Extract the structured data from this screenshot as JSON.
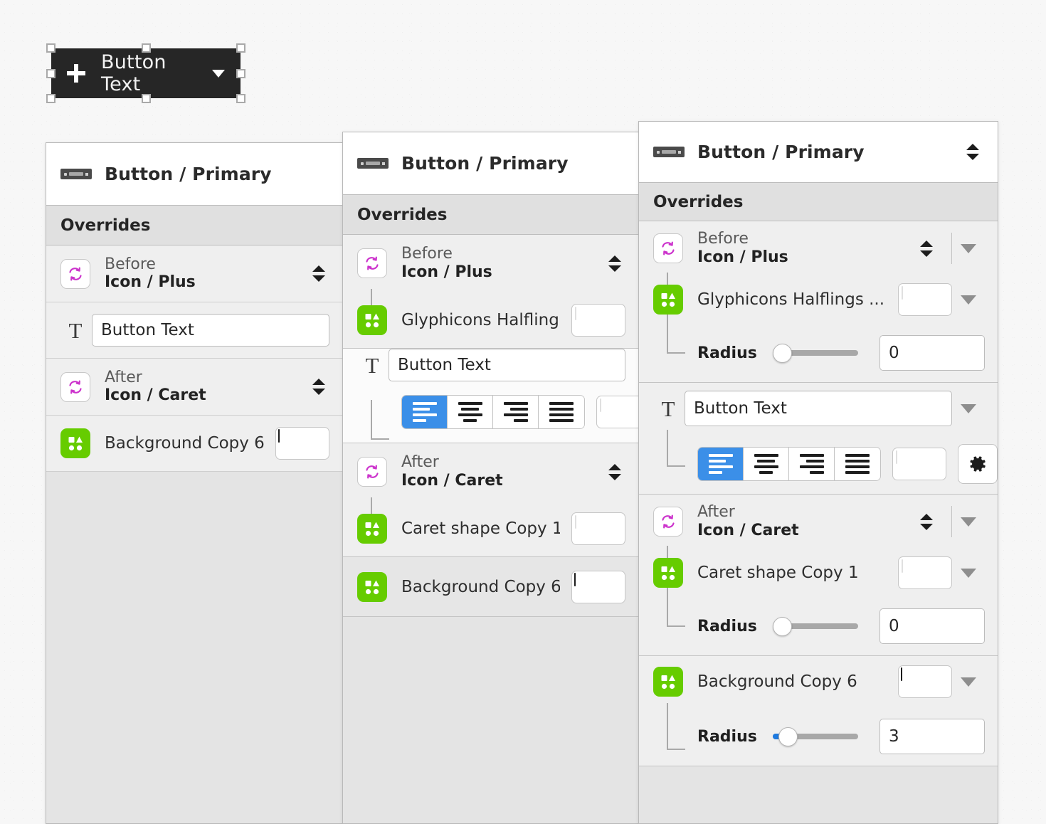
{
  "canvas": {
    "button_preview": {
      "label": "Button Text",
      "plus_icon": "plus-icon",
      "caret_icon": "caret-down-icon",
      "background_color": "#262626",
      "text_color": "#f2f2f2"
    }
  },
  "colors": {
    "accent_blue": "#3b8fe8",
    "slider_blue": "#1d7ae0",
    "symbol_magenta": "#cc33cc",
    "shape_green": "#66cc00",
    "dark_swatch": "#262626",
    "white_swatch": "#ffffff"
  },
  "panels": [
    {
      "id": "panel-1",
      "title": "Button / Primary",
      "section_title": "Overrides",
      "rows": [
        {
          "kind": "symbol",
          "icon": "symbol-instance-icon",
          "sub_label": "Before",
          "main_label": "Icon / Plus",
          "stepper": "stepper-updown"
        },
        {
          "kind": "text",
          "icon": "text-override-icon",
          "value": "Button Text"
        },
        {
          "kind": "symbol",
          "icon": "symbol-instance-icon",
          "sub_label": "After",
          "main_label": "Icon / Caret",
          "stepper": "stepper-updown"
        },
        {
          "kind": "shape",
          "icon": "shapes-icon",
          "label": "Background Copy 6",
          "swatch": "#262626"
        }
      ]
    },
    {
      "id": "panel-2",
      "title": "Button / Primary",
      "section_title": "Overrides",
      "rows": [
        {
          "kind": "symbol",
          "icon": "symbol-instance-icon",
          "sub_label": "Before",
          "main_label": "Icon / Plus",
          "stepper": "stepper-updown"
        },
        {
          "kind": "shape",
          "icon": "shapes-icon",
          "label": "Glyphicons Halflings ...",
          "swatch": "#ffffff"
        },
        {
          "kind": "text",
          "icon": "text-override-icon",
          "value": "Button Text",
          "alignment_selected": 0,
          "alignment_options": [
            "align-left",
            "align-center",
            "align-right",
            "align-justify"
          ],
          "swatch": "#ffffff"
        },
        {
          "kind": "symbol",
          "icon": "symbol-instance-icon",
          "sub_label": "After",
          "main_label": "Icon / Caret",
          "stepper": "stepper-updown"
        },
        {
          "kind": "shape",
          "icon": "shapes-icon",
          "label": "Caret shape Copy 1",
          "swatch": "#ffffff"
        },
        {
          "kind": "shape",
          "icon": "shapes-icon",
          "label": "Background Copy 6",
          "swatch": "#262626"
        }
      ]
    },
    {
      "id": "panel-3",
      "title": "Button / Primary",
      "section_title": "Overrides",
      "header_stepper": "stepper-updown",
      "groups": [
        {
          "parent": {
            "icon": "symbol-instance-icon",
            "sub_label": "Before",
            "main_label": "Icon / Plus",
            "stepper": "stepper-updown",
            "disclosure": "chevron-down-icon"
          },
          "child": {
            "icon": "shapes-icon",
            "label": "Glyphicons Halflings ...",
            "swatch": "#ffffff",
            "disclosure": "chevron-down-icon"
          },
          "radius": {
            "label": "Radius",
            "value": "0",
            "percent": 0
          }
        },
        {
          "parent": {
            "icon": "text-override-icon",
            "value": "Button Text",
            "disclosure": "chevron-down-icon"
          },
          "alignment_selected": 0,
          "alignment_options": [
            "align-left",
            "align-center",
            "align-right",
            "align-justify"
          ],
          "swatch": "#ffffff",
          "gear": "gear-icon"
        },
        {
          "parent": {
            "icon": "symbol-instance-icon",
            "sub_label": "After",
            "main_label": "Icon / Caret",
            "stepper": "stepper-updown",
            "disclosure": "chevron-down-icon"
          },
          "child": {
            "icon": "shapes-icon",
            "label": "Caret shape Copy 1",
            "swatch": "#ffffff",
            "disclosure": "chevron-down-icon"
          },
          "radius": {
            "label": "Radius",
            "value": "0",
            "percent": 0
          }
        },
        {
          "parent": {
            "icon": "shapes-icon",
            "label": "Background Copy 6",
            "swatch": "#262626",
            "disclosure": "chevron-down-icon"
          },
          "radius": {
            "label": "Radius",
            "value": "3",
            "percent": 10
          }
        }
      ]
    }
  ]
}
